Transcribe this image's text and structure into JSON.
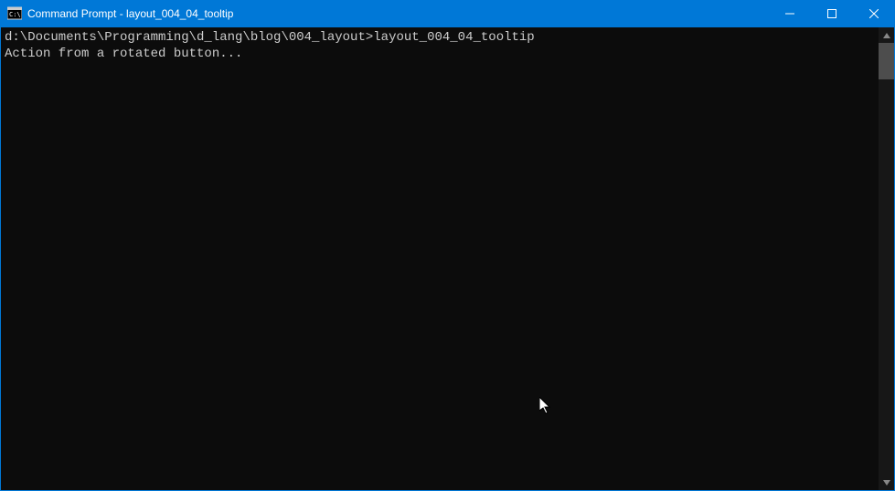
{
  "window": {
    "title": "Command Prompt - layout_004_04_tooltip"
  },
  "terminal": {
    "prompt_path": "d:\\Documents\\Programming\\d_lang\\blog\\004_layout>",
    "command": "layout_004_04_tooltip",
    "output_line_1": "Action from a rotated button..."
  }
}
